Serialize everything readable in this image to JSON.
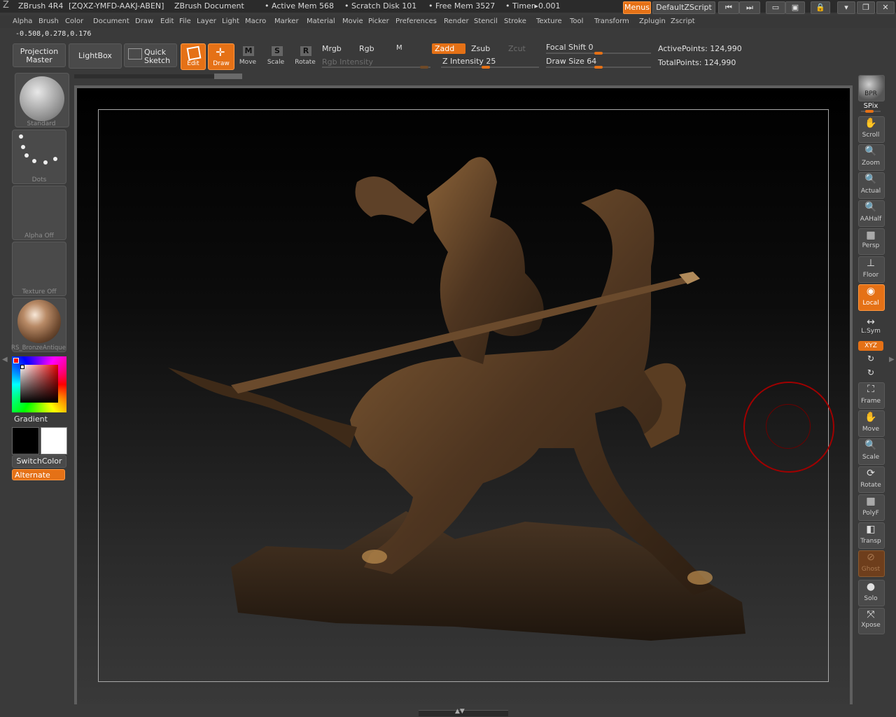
{
  "titlebar": {
    "app": "ZBrush 4R4",
    "serial": "[ZQXZ-YMFD-AAKJ-ABEN]",
    "document": "ZBrush Document",
    "active_mem": "• Active Mem 568",
    "scratch_disk": "• Scratch Disk 101",
    "free_mem": "• Free Mem 3527",
    "timer": "• Timer▸0.001",
    "menus_button": "Menus",
    "script_button": "DefaultZScript"
  },
  "menu": [
    "Alpha",
    "Brush",
    "Color",
    "Document",
    "Draw",
    "Edit",
    "File",
    "Layer",
    "Light",
    "Macro",
    "Marker",
    "Material",
    "Movie",
    "Picker",
    "Preferences",
    "Render",
    "Stencil",
    "Stroke",
    "Texture",
    "Tool",
    "Transform",
    "Zplugin",
    "Zscript"
  ],
  "coords": "-0.508,0.278,0.176",
  "toolbar": {
    "projection_master": "Projection Master",
    "lightbox": "LightBox",
    "quick_sketch": "Quick Sketch",
    "edit": "Edit",
    "draw": "Draw",
    "move": "Move",
    "scale": "Scale",
    "rotate": "Rotate",
    "mrgb": "Mrgb",
    "rgb": "Rgb",
    "m": "M",
    "zadd": "Zadd",
    "zsub": "Zsub",
    "zcut": "Zcut",
    "rgb_intensity": "Rgb Intensity",
    "z_intensity": "Z Intensity 25",
    "focal_shift": "Focal Shift 0",
    "draw_size": "Draw Size 64",
    "active_points": "ActivePoints: 124,990",
    "total_points": "TotalPoints: 124,990"
  },
  "left_shelf": {
    "brush": "Standard",
    "stroke": "Dots",
    "alpha": "Alpha  Off",
    "texture": "Texture  Off",
    "material": "RS_BronzeAntique",
    "gradient": "Gradient",
    "switch_color": "SwitchColor",
    "alternate": "Alternate"
  },
  "right_shelf": [
    "BPR",
    "SPix",
    "Scroll",
    "Zoom",
    "Actual",
    "AAHalf",
    "Persp",
    "Floor",
    "Local",
    "L.Sym",
    "XYZ",
    "Frame",
    "Move",
    "Scale",
    "Rotate",
    "PolyF",
    "Transp",
    "Ghost",
    "Solo",
    "Xpose"
  ],
  "colors": {
    "accent": "#e57116",
    "panel": "#3a3a3a",
    "bronze": "#6b4a2a"
  }
}
